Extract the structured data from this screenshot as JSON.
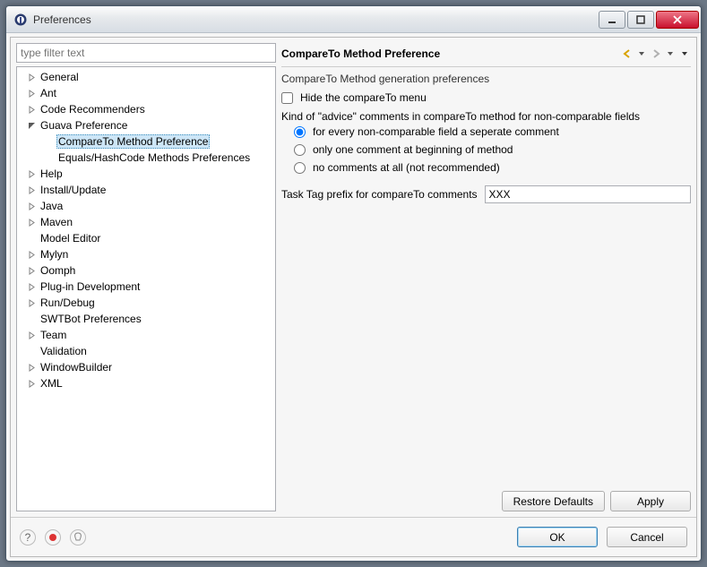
{
  "window": {
    "title": "Preferences"
  },
  "filter": {
    "placeholder": "type filter text"
  },
  "tree": {
    "items": [
      {
        "label": "General",
        "depth": 0,
        "expandable": true,
        "expanded": false
      },
      {
        "label": "Ant",
        "depth": 0,
        "expandable": true,
        "expanded": false
      },
      {
        "label": "Code Recommenders",
        "depth": 0,
        "expandable": true,
        "expanded": false
      },
      {
        "label": "Guava Preference",
        "depth": 0,
        "expandable": true,
        "expanded": true
      },
      {
        "label": "CompareTo Method Preference",
        "depth": 1,
        "expandable": false,
        "expanded": false,
        "selected": true
      },
      {
        "label": "Equals/HashCode Methods Preferences",
        "depth": 1,
        "expandable": false,
        "expanded": false
      },
      {
        "label": "Help",
        "depth": 0,
        "expandable": true,
        "expanded": false
      },
      {
        "label": "Install/Update",
        "depth": 0,
        "expandable": true,
        "expanded": false
      },
      {
        "label": "Java",
        "depth": 0,
        "expandable": true,
        "expanded": false
      },
      {
        "label": "Maven",
        "depth": 0,
        "expandable": true,
        "expanded": false
      },
      {
        "label": "Model Editor",
        "depth": 0,
        "expandable": false,
        "expanded": false
      },
      {
        "label": "Mylyn",
        "depth": 0,
        "expandable": true,
        "expanded": false
      },
      {
        "label": "Oomph",
        "depth": 0,
        "expandable": true,
        "expanded": false
      },
      {
        "label": "Plug-in Development",
        "depth": 0,
        "expandable": true,
        "expanded": false
      },
      {
        "label": "Run/Debug",
        "depth": 0,
        "expandable": true,
        "expanded": false
      },
      {
        "label": "SWTBot Preferences",
        "depth": 0,
        "expandable": false,
        "expanded": false
      },
      {
        "label": "Team",
        "depth": 0,
        "expandable": true,
        "expanded": false
      },
      {
        "label": "Validation",
        "depth": 0,
        "expandable": false,
        "expanded": false
      },
      {
        "label": "WindowBuilder",
        "depth": 0,
        "expandable": true,
        "expanded": false
      },
      {
        "label": "XML",
        "depth": 0,
        "expandable": true,
        "expanded": false
      }
    ]
  },
  "page": {
    "title": "CompareTo Method Preference",
    "description": "CompareTo Method generation preferences",
    "hideMenu": {
      "label": "Hide the compareTo menu",
      "checked": false
    },
    "adviceGroupLabel": "Kind of \"advice\" comments in compareTo method for non-comparable fields",
    "adviceOptions": [
      {
        "label": "for every non-comparable field a seperate comment",
        "checked": true
      },
      {
        "label": "only one comment at beginning of method",
        "checked": false
      },
      {
        "label": "no comments at all (not recommended)",
        "checked": false
      }
    ],
    "taskTag": {
      "label": "Task Tag prefix for compareTo comments",
      "value": "XXX"
    }
  },
  "buttons": {
    "restoreDefaults": "Restore Defaults",
    "apply": "Apply",
    "ok": "OK",
    "cancel": "Cancel"
  }
}
